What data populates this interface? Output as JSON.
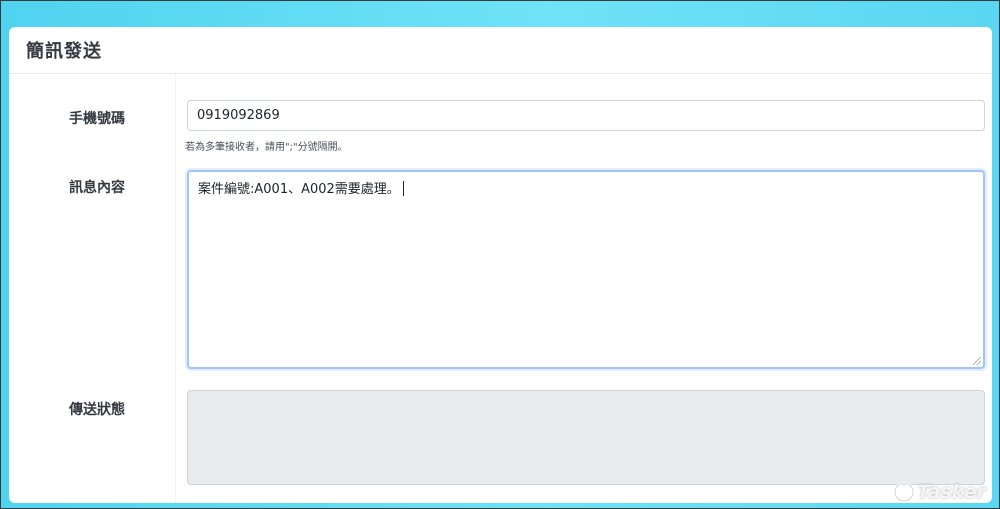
{
  "page": {
    "title": "簡訊發送"
  },
  "form": {
    "phone": {
      "label": "手機號碼",
      "value": "0919092869",
      "help": "若為多筆接收者，請用\";\"分號隔開。"
    },
    "message": {
      "label": "訊息內容",
      "value": "案件編號:A001、A002需要處理。"
    },
    "status": {
      "label": "傳送狀態",
      "value": ""
    }
  },
  "branding": {
    "logo_text": "Tasker"
  },
  "colors": {
    "background_accent": "#4fd3ef",
    "focus_border": "#9ec5fe",
    "disabled_bg": "#e9ecef"
  }
}
